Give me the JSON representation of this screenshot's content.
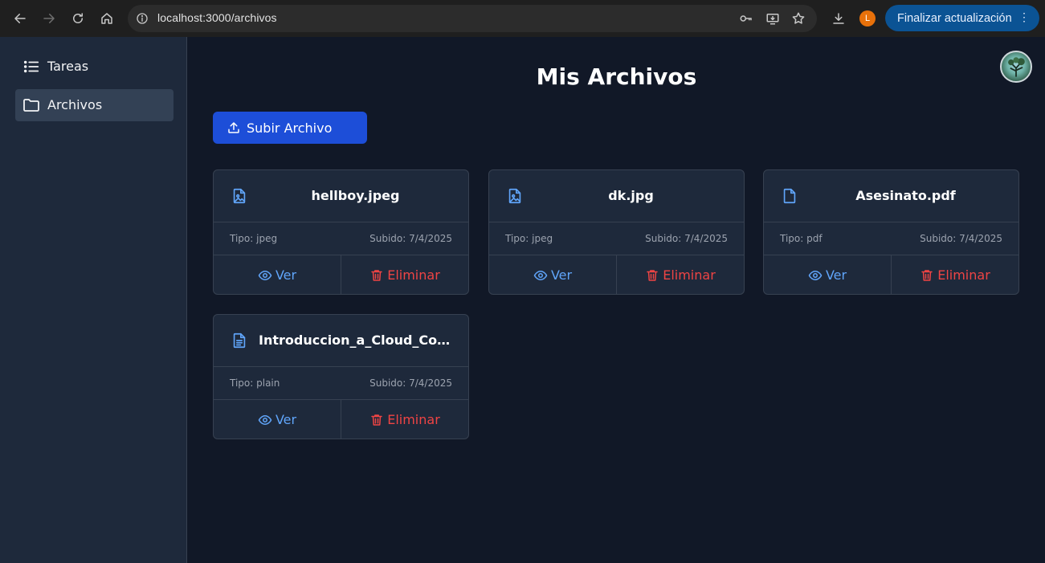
{
  "browser": {
    "url": "localhost:3000/archivos",
    "profile_initial": "L",
    "update_label": "Finalizar actualización",
    "kebab": "⋮",
    "icons": [
      "back-icon",
      "forward-icon",
      "reload-icon",
      "home-icon",
      "info-icon",
      "key-icon",
      "install-icon",
      "star-icon",
      "download-icon"
    ]
  },
  "sidebar": {
    "items": [
      {
        "label": "Tareas",
        "icon": "list-icon",
        "active": false
      },
      {
        "label": "Archivos",
        "icon": "folder-icon",
        "active": true
      }
    ]
  },
  "main": {
    "title": "Mis Archivos",
    "upload_label": "Subir Archivo",
    "files": [
      {
        "name": "hellboy.jpeg",
        "type": "Tipo: jpeg",
        "date": "Subido: 7/4/2025",
        "icon": "image-file-icon",
        "view": "Ver",
        "delete": "Eliminar"
      },
      {
        "name": "dk.jpg",
        "type": "Tipo: jpeg",
        "date": "Subido: 7/4/2025",
        "icon": "image-file-icon",
        "view": "Ver",
        "delete": "Eliminar"
      },
      {
        "name": "Asesinato.pdf",
        "type": "Tipo: pdf",
        "date": "Subido: 7/4/2025",
        "icon": "file-icon",
        "view": "Ver",
        "delete": "Eliminar"
      },
      {
        "name": "Introduccion_a_Cloud_Computing",
        "type": "Tipo: plain",
        "date": "Subido: 7/4/2025",
        "icon": "text-file-icon",
        "view": "Ver",
        "delete": "Eliminar"
      }
    ]
  },
  "colors": {
    "background": "#111827",
    "sidebar": "#1e293b",
    "card": "#1e293b",
    "accent": "#1d4ed8",
    "view": "#60a5fa",
    "delete": "#ef4444"
  }
}
